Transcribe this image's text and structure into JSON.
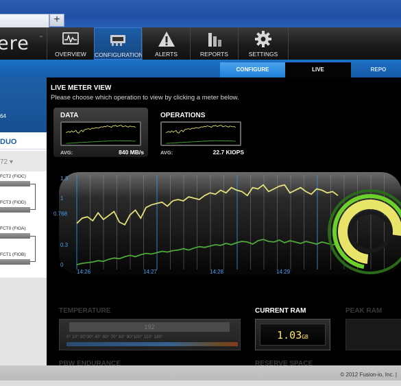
{
  "browser": {
    "new_tab_symbol": "+"
  },
  "app": {
    "logo_text": "ere",
    "logo_tm": "™"
  },
  "nav": {
    "items": [
      {
        "label": "OVERVIEW",
        "icon": "overview-icon"
      },
      {
        "label": "CONFIGURATION",
        "icon": "configuration-icon"
      },
      {
        "label": "ALERTS",
        "icon": "alert-icon"
      },
      {
        "label": "REPORTS",
        "icon": "reports-icon"
      },
      {
        "label": "SETTINGS",
        "icon": "gear-icon"
      }
    ],
    "active": "CONFIGURATION"
  },
  "subnav": {
    "configure": "CONFIGURE",
    "live": "LIVE",
    "reports": "REPO"
  },
  "left": {
    "number": "64",
    "duo": "DUO",
    "selector": "72",
    "devices": [
      "FCT2 (FIOC)",
      "FCT3 (FIOD)",
      "FCT0 (FIOA)",
      "FCT1 (FIOB)"
    ]
  },
  "live": {
    "title": "LIVE METER VIEW",
    "subtitle": "Please choose which operation to view by clicking a meter below.",
    "meters": [
      {
        "label": "DATA",
        "avg_label": "AVG:",
        "avg_value": "840 MB/s"
      },
      {
        "label": "OPERATIONS",
        "avg_label": "AVG:",
        "avg_value": "22.7 KIOPS"
      }
    ]
  },
  "chart_data": {
    "type": "line",
    "title": "",
    "x_ticks": [
      "14:26",
      "14:27",
      "14:28",
      "14:29"
    ],
    "y_ticks": [
      "1.3",
      "1",
      "0.768",
      "0.3",
      "0"
    ],
    "ylim": [
      0,
      1.3
    ],
    "series": [
      {
        "color": "#e6e07a",
        "values": [
          0.62,
          0.7,
          0.72,
          0.66,
          0.78,
          0.68,
          0.74,
          0.8,
          0.64,
          0.6,
          0.75,
          0.82,
          0.7,
          0.86,
          0.9,
          0.92,
          0.94,
          0.88,
          0.96,
          0.98,
          0.96,
          1.02,
          1.0,
          0.98,
          1.04,
          1.08,
          1.06,
          1.12,
          1.08,
          1.16,
          1.12,
          1.1,
          1.04,
          1.16,
          1.14,
          1.2,
          1.1,
          1.14,
          1.18,
          1.2,
          1.08,
          1.12,
          1.16,
          1.1,
          1.06,
          1.14,
          1.12,
          1.08,
          1.1,
          1.04
        ]
      },
      {
        "color": "#4ea83a",
        "values": [
          0.0,
          0.02,
          0.03,
          0.04,
          0.06,
          0.05,
          0.08,
          0.1,
          0.09,
          0.12,
          0.14,
          0.12,
          0.15,
          0.17,
          0.16,
          0.18,
          0.2,
          0.19,
          0.21,
          0.22,
          0.24,
          0.22,
          0.25,
          0.27,
          0.26,
          0.28,
          0.3,
          0.29,
          0.32,
          0.3,
          0.33,
          0.35,
          0.34,
          0.31,
          0.36,
          0.38,
          0.35,
          0.34,
          0.37,
          0.33,
          0.36,
          0.34,
          0.32,
          0.35,
          0.33,
          0.31,
          0.34,
          0.32,
          0.3,
          0.31
        ]
      }
    ]
  },
  "sections": {
    "temperature": "TEMPERATURE",
    "temp_value": "192",
    "temp_scale": "0° 10° 20°30° 40° 60° 70° 80° 90°100° 110° 180°",
    "current_ram": "CURRENT RAM",
    "ram_value": "1.03",
    "ram_unit": "GB",
    "peak_ram": "PEAK RAM",
    "pbw": "PBW ENDURANCE",
    "reserve": "RESERVE SPACE"
  },
  "footer": {
    "copyright": "© 2012 Fusion-io, Inc. |"
  }
}
